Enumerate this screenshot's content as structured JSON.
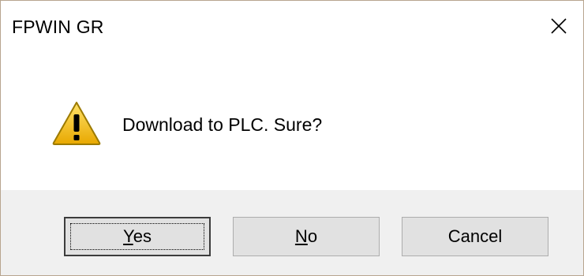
{
  "window": {
    "title": "FPWIN GR",
    "close_icon": "close-icon"
  },
  "message": {
    "icon": "warning-icon",
    "text": "Download to PLC. Sure?"
  },
  "buttons": {
    "yes": {
      "mnemonic": "Y",
      "rest": "es",
      "label": "Yes",
      "focused": true
    },
    "no": {
      "mnemonic": "N",
      "rest": "o",
      "label": "No"
    },
    "cancel": {
      "label": "Cancel"
    }
  },
  "colors": {
    "warning_fill": "#f2c418",
    "footer_bg": "#f0f0f0",
    "button_bg": "#e1e1e1"
  }
}
